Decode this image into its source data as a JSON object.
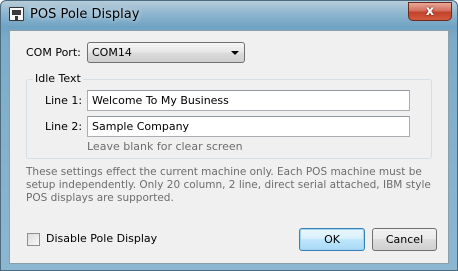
{
  "window": {
    "title": "POS Pole Display",
    "close_glyph": "x",
    "app_icon": "monitor-icon"
  },
  "com_port": {
    "label": "COM Port:",
    "value": "COM14"
  },
  "idle_text": {
    "group_label": "Idle Text",
    "line1_label": "Line 1:",
    "line1_value": "Welcome To My Business",
    "line2_label": "Line 2:",
    "line2_value": "Sample Company",
    "hint": "Leave blank for clear screen"
  },
  "note": "These settings effect the current machine only. Each POS machine must be setup independently. Only 20 column, 2 line, direct serial attached, IBM style POS displays are supported.",
  "disable_checkbox": {
    "label": "Disable Pole Display",
    "checked": false
  },
  "buttons": {
    "ok": "OK",
    "cancel": "Cancel"
  },
  "colors": {
    "title_bar": "#7dabc7",
    "close_button": "#c2422a",
    "dialog_bg": "#f0f0f0",
    "default_button_border": "#3c7fb1",
    "hint_text": "#6d6d6d"
  }
}
